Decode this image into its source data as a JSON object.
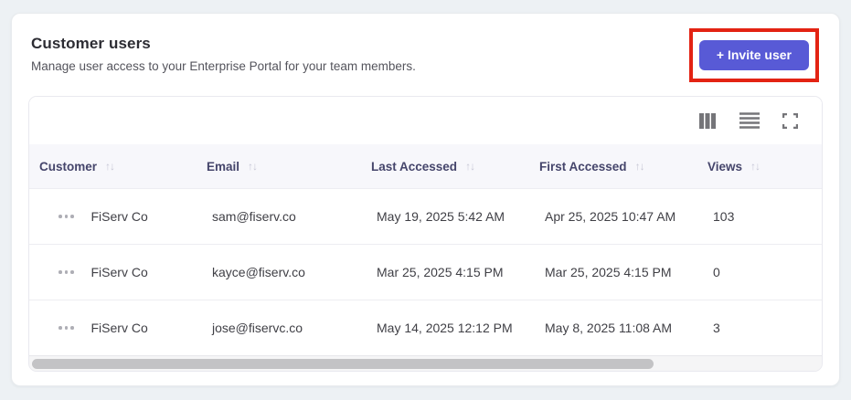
{
  "page": {
    "title": "Customer users",
    "subtitle": "Manage user access to your Enterprise Portal for your team members."
  },
  "invite_button": {
    "label": "+ Invite user"
  },
  "toolbar": {
    "icons": [
      "columns-icon",
      "density-icon",
      "fullscreen-icon"
    ]
  },
  "table": {
    "sort_icon_glyph": "↑↓",
    "row_menu_icon": "ellipsis-icon",
    "columns": [
      {
        "label": "Customer",
        "sortable": true
      },
      {
        "label": "Email",
        "sortable": true
      },
      {
        "label": "Last Accessed",
        "sortable": true
      },
      {
        "label": "First Accessed",
        "sortable": true
      },
      {
        "label": "Views",
        "sortable": true
      }
    ],
    "rows": [
      {
        "customer": "FiServ Co",
        "email": "sam@fiserv.co",
        "last_accessed": "May 19, 2025 5:42 AM",
        "first_accessed": "Apr 25, 2025 10:47 AM",
        "views": "103"
      },
      {
        "customer": "FiServ Co",
        "email": "kayce@fiserv.co",
        "last_accessed": "Mar 25, 2025 4:15 PM",
        "first_accessed": "Mar 25, 2025 4:15 PM",
        "views": "0"
      },
      {
        "customer": "FiServ Co",
        "email": "jose@fiservc.co",
        "last_accessed": "May 14, 2025 12:12 PM",
        "first_accessed": "May 8, 2025 11:08 AM",
        "views": "3"
      }
    ]
  },
  "colors": {
    "accent": "#585ad6",
    "annotation_red": "#e32313",
    "page_background": "#edf1f4",
    "header_background": "#f7f7fb",
    "header_text": "#45456b",
    "body_text": "#3f3f45",
    "sort_icon": "#c7c7d6",
    "toolbar_icon": "#757579",
    "scrollbar_thumb": "#c3c3c5"
  }
}
